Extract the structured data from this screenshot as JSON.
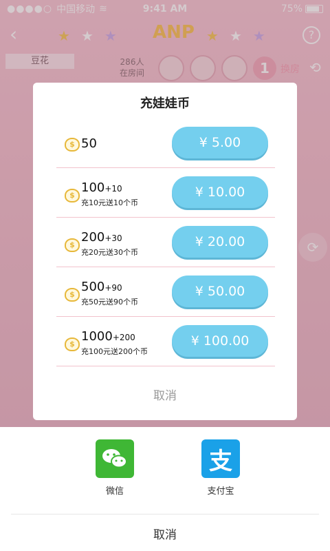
{
  "status_bar": {
    "carrier": "中国移动",
    "time": "9:41 AM",
    "battery": "75%"
  },
  "navbar": {
    "logo": "ANP"
  },
  "room": {
    "tab_name": "豆花",
    "count": "286人",
    "count_label": "在房间",
    "queue_number": "1",
    "swap_label": "换房"
  },
  "dialog": {
    "title": "充娃娃币",
    "options": [
      {
        "amount": "50",
        "bonus": "",
        "note": "",
        "price": "¥ 5.00"
      },
      {
        "amount": "100",
        "bonus": "+10",
        "note": "充10元送10个币",
        "price": "¥ 10.00"
      },
      {
        "amount": "200",
        "bonus": "+30",
        "note": "充20元送30个币",
        "price": "¥ 20.00"
      },
      {
        "amount": "500",
        "bonus": "+90",
        "note": "充50元送90个币",
        "price": "¥ 50.00"
      },
      {
        "amount": "1000",
        "bonus": "+200",
        "note": "充100元送200个币",
        "price": "¥ 100.00"
      }
    ],
    "cancel": "取消"
  },
  "payment_sheet": {
    "methods": [
      {
        "label": "微信",
        "icon": "wechat-icon"
      },
      {
        "label": "支付宝",
        "icon": "alipay-icon"
      }
    ],
    "alipay_glyph": "支",
    "cancel": "取消"
  },
  "colors": {
    "accent": "#74cfee",
    "coin": "#e7b83a",
    "wechat": "#3fb735",
    "alipay": "#1aa1e8"
  }
}
